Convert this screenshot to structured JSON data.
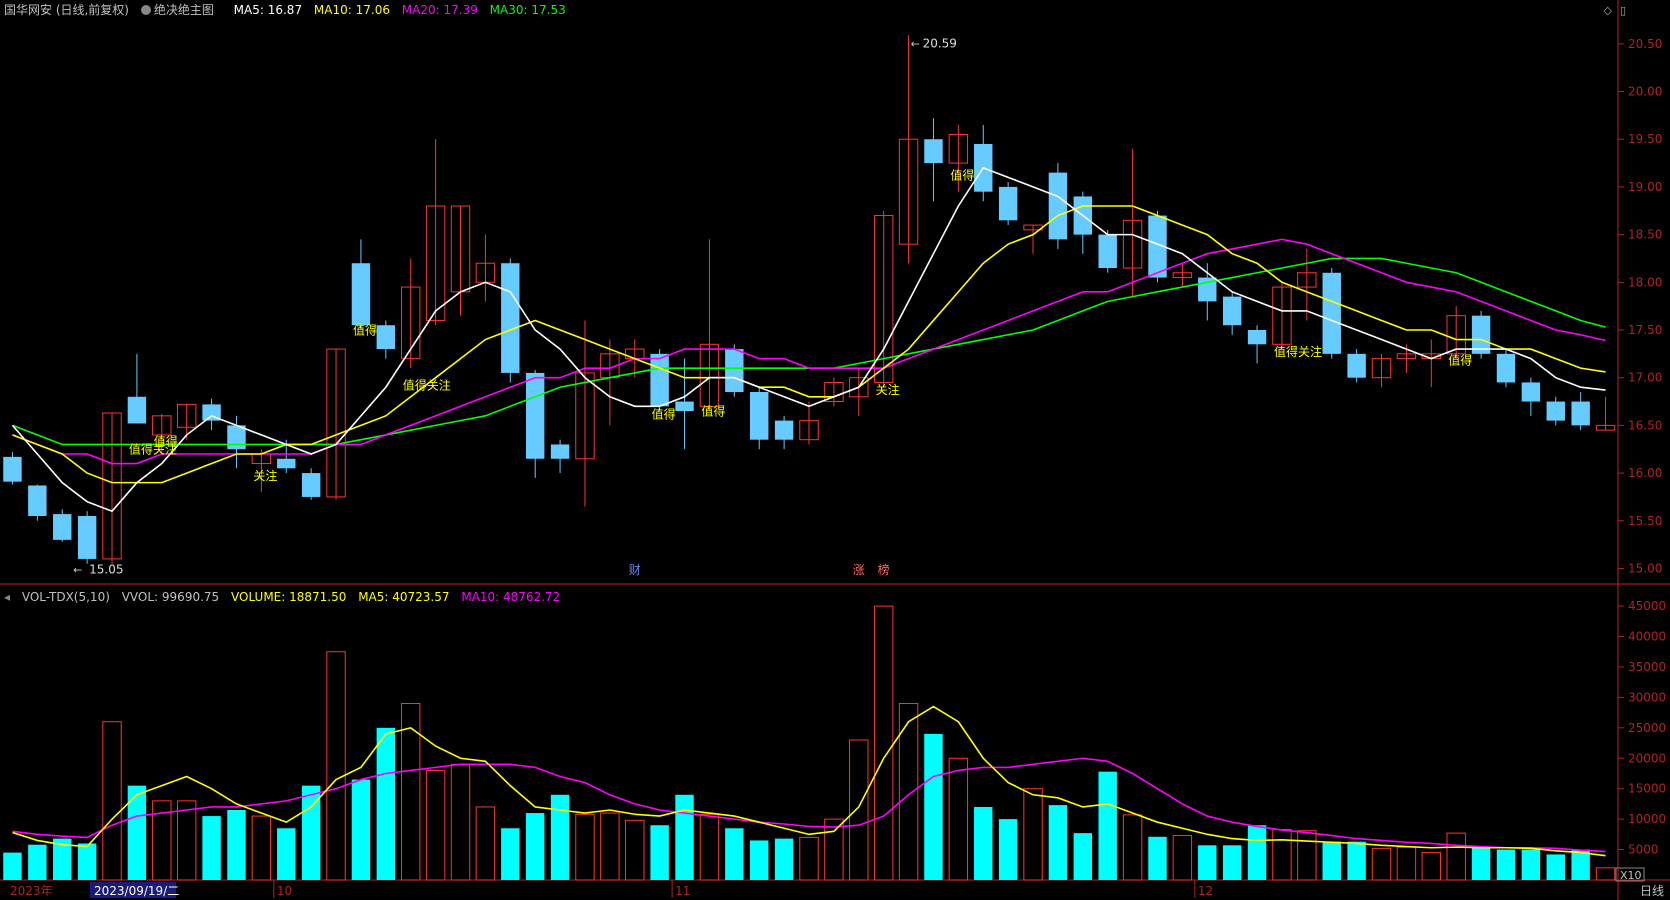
{
  "header": {
    "stock_name": "国华网安 (日线,前复权)",
    "indicator_name": "绝决绝主图",
    "ma5": "MA5: 16.87",
    "ma10": "MA10: 17.06",
    "ma20": "MA20: 17.39",
    "ma30": "MA30: 17.53"
  },
  "vol_header": {
    "name": "VOL-TDX(5,10)",
    "vvol": "VVOL: 99690.75",
    "volume": "VOLUME: 18871.50",
    "ma5": "MA5: 40723.57",
    "ma10": "MA10: 48762.72"
  },
  "colors": {
    "ma5": "#ffffff",
    "ma10": "#ffff00",
    "ma20": "#ff00ff",
    "ma30": "#00ff00",
    "up": "#ff3333",
    "down_candle": "#66ccff",
    "down_vol": "#00ffff",
    "axis": "#b22222",
    "label": "#ffff00"
  },
  "price_axis": [
    "20.50",
    "20.00",
    "19.50",
    "19.00",
    "18.50",
    "18.00",
    "17.50",
    "17.00",
    "16.50",
    "16.00",
    "15.50",
    "15.00"
  ],
  "volume_axis": [
    "45000",
    "40000",
    "35000",
    "30000",
    "25000",
    "20000",
    "15000",
    "10000",
    "5000"
  ],
  "date_axis": {
    "year": "2023年",
    "cursor_date": "2023/09/19/二",
    "months": [
      "10",
      "11",
      "12"
    ],
    "right_label": "日线",
    "zoom": "X10"
  },
  "markers": {
    "high": "20.59",
    "low": "15.05",
    "event_cai": "财",
    "event_zhang": "涨",
    "event_bang": "榜"
  },
  "signals": [
    "值得关注",
    "值得",
    "关注",
    "值得",
    "值得关注",
    "值得",
    "值得",
    "关注",
    "值得",
    "值得关注",
    "值得"
  ],
  "chart_data": {
    "type": "candlestick",
    "candles": [
      [
        16.17,
        15.91,
        16.22,
        15.88
      ],
      [
        15.87,
        15.55,
        15.88,
        15.5
      ],
      [
        15.57,
        15.3,
        15.62,
        15.28
      ],
      [
        15.55,
        15.1,
        15.6,
        15.05
      ],
      [
        15.1,
        16.63,
        16.63,
        15.05
      ],
      [
        16.8,
        16.52,
        17.25,
        16.52
      ],
      [
        16.4,
        16.6,
        16.62,
        16.2
      ],
      [
        16.48,
        16.72,
        16.72,
        16.35
      ],
      [
        16.72,
        16.55,
        16.78,
        16.45
      ],
      [
        16.5,
        16.25,
        16.6,
        16.05
      ],
      [
        16.1,
        16.2,
        16.25,
        15.8
      ],
      [
        16.15,
        16.05,
        16.35,
        16.0
      ],
      [
        16.0,
        15.75,
        16.05,
        15.72
      ],
      [
        15.75,
        17.3,
        17.3,
        15.72
      ],
      [
        18.2,
        17.55,
        18.45,
        17.5
      ],
      [
        17.55,
        17.3,
        17.6,
        17.2
      ],
      [
        17.2,
        17.95,
        18.25,
        17.1
      ],
      [
        17.6,
        18.8,
        19.5,
        17.55
      ],
      [
        17.9,
        18.8,
        18.8,
        17.65
      ],
      [
        18.0,
        18.2,
        18.5,
        17.8
      ],
      [
        18.2,
        17.05,
        18.25,
        16.95
      ],
      [
        17.05,
        16.15,
        17.08,
        15.95
      ],
      [
        16.3,
        16.15,
        16.35,
        16.0
      ],
      [
        16.15,
        17.05,
        17.6,
        15.65
      ],
      [
        17.0,
        17.25,
        17.4,
        16.5
      ],
      [
        17.2,
        17.3,
        17.4,
        17.0
      ],
      [
        17.25,
        16.7,
        17.3,
        16.65
      ],
      [
        16.75,
        16.65,
        17.2,
        16.25
      ],
      [
        16.7,
        17.35,
        18.45,
        16.65
      ],
      [
        17.3,
        16.85,
        17.35,
        16.8
      ],
      [
        16.85,
        16.35,
        16.9,
        16.25
      ],
      [
        16.55,
        16.35,
        16.6,
        16.25
      ],
      [
        16.35,
        16.55,
        16.75,
        16.3
      ],
      [
        16.75,
        16.95,
        17.0,
        16.7
      ],
      [
        16.8,
        17.0,
        17.1,
        16.6
      ],
      [
        16.95,
        18.7,
        18.75,
        16.9
      ],
      [
        18.4,
        19.5,
        20.59,
        18.2
      ],
      [
        19.5,
        19.25,
        19.72,
        18.85
      ],
      [
        19.25,
        19.55,
        19.65,
        18.95
      ],
      [
        19.45,
        18.95,
        19.65,
        18.85
      ],
      [
        19.0,
        18.65,
        19.05,
        18.6
      ],
      [
        18.55,
        18.6,
        18.6,
        18.3
      ],
      [
        19.15,
        18.45,
        19.25,
        18.35
      ],
      [
        18.9,
        18.5,
        18.95,
        18.3
      ],
      [
        18.5,
        18.15,
        18.55,
        18.1
      ],
      [
        18.15,
        18.65,
        19.4,
        17.85
      ],
      [
        18.7,
        18.05,
        18.75,
        18.0
      ],
      [
        18.05,
        18.1,
        18.2,
        17.95
      ],
      [
        18.05,
        17.8,
        18.2,
        17.6
      ],
      [
        17.85,
        17.55,
        17.9,
        17.45
      ],
      [
        17.5,
        17.35,
        17.55,
        17.15
      ],
      [
        17.35,
        17.95,
        18.0,
        17.3
      ],
      [
        17.95,
        18.1,
        18.35,
        17.6
      ],
      [
        18.1,
        17.25,
        18.15,
        17.2
      ],
      [
        17.25,
        17.0,
        17.3,
        16.95
      ],
      [
        17.0,
        17.2,
        17.25,
        16.9
      ],
      [
        17.2,
        17.25,
        17.35,
        17.05
      ],
      [
        17.2,
        17.25,
        17.4,
        16.9
      ],
      [
        17.25,
        17.65,
        17.75,
        17.2
      ],
      [
        17.65,
        17.25,
        17.7,
        17.2
      ],
      [
        17.25,
        16.95,
        17.3,
        16.9
      ],
      [
        16.95,
        16.75,
        17.0,
        16.6
      ],
      [
        16.75,
        16.55,
        16.8,
        16.5
      ],
      [
        16.75,
        16.5,
        16.85,
        16.45
      ],
      [
        16.45,
        16.5,
        16.8,
        16.45
      ]
    ],
    "volume": [
      4500,
      5800,
      6800,
      6000,
      26000,
      15500,
      13000,
      13000,
      10500,
      11500,
      10500,
      8500,
      15500,
      37500,
      16500,
      25000,
      29000,
      18000,
      19000,
      12000,
      8500,
      11000,
      14000,
      10800,
      11000,
      9800,
      9000,
      14000,
      10800,
      8500,
      6500,
      6800,
      7000,
      10000,
      23000,
      45000,
      29000,
      24000,
      20000,
      12000,
      10000,
      15000,
      12300,
      7700,
      17800,
      10700,
      7100,
      7300,
      5700,
      5700,
      9000,
      8300,
      8100,
      6300,
      6300,
      5200,
      5400,
      4500,
      7700,
      5500,
      5000,
      5000,
      4200,
      5000,
      2000
    ],
    "ma5": [
      16.5,
      16.2,
      15.9,
      15.7,
      15.6,
      15.9,
      16.1,
      16.4,
      16.6,
      16.5,
      16.4,
      16.3,
      16.2,
      16.3,
      16.6,
      16.9,
      17.3,
      17.7,
      17.9,
      18.0,
      17.9,
      17.5,
      17.3,
      17.0,
      16.8,
      16.7,
      16.7,
      16.8,
      17.0,
      17.0,
      16.9,
      16.8,
      16.7,
      16.8,
      16.9,
      17.3,
      17.8,
      18.3,
      18.8,
      19.2,
      19.1,
      19.0,
      18.9,
      18.7,
      18.5,
      18.5,
      18.4,
      18.3,
      18.1,
      17.9,
      17.8,
      17.7,
      17.7,
      17.6,
      17.5,
      17.4,
      17.3,
      17.2,
      17.3,
      17.3,
      17.3,
      17.2,
      17.0,
      16.9,
      16.87
    ],
    "ma10": [
      16.4,
      16.3,
      16.2,
      16.0,
      15.9,
      15.9,
      15.9,
      16.0,
      16.1,
      16.2,
      16.2,
      16.3,
      16.3,
      16.4,
      16.5,
      16.6,
      16.8,
      17.0,
      17.2,
      17.4,
      17.5,
      17.6,
      17.5,
      17.4,
      17.3,
      17.2,
      17.1,
      17.0,
      17.0,
      17.0,
      16.9,
      16.9,
      16.8,
      16.8,
      16.9,
      17.1,
      17.3,
      17.6,
      17.9,
      18.2,
      18.4,
      18.5,
      18.7,
      18.8,
      18.8,
      18.8,
      18.7,
      18.6,
      18.5,
      18.3,
      18.2,
      18.0,
      17.9,
      17.8,
      17.7,
      17.6,
      17.5,
      17.5,
      17.4,
      17.4,
      17.3,
      17.3,
      17.2,
      17.1,
      17.06
    ],
    "ma20": [
      16.4,
      16.3,
      16.2,
      16.2,
      16.1,
      16.1,
      16.2,
      16.2,
      16.2,
      16.2,
      16.2,
      16.2,
      16.2,
      16.3,
      16.3,
      16.4,
      16.5,
      16.6,
      16.7,
      16.8,
      16.9,
      17.0,
      17.0,
      17.1,
      17.1,
      17.2,
      17.2,
      17.3,
      17.3,
      17.3,
      17.2,
      17.2,
      17.1,
      17.1,
      17.1,
      17.1,
      17.2,
      17.3,
      17.4,
      17.5,
      17.6,
      17.7,
      17.8,
      17.9,
      17.9,
      18.0,
      18.1,
      18.2,
      18.3,
      18.35,
      18.4,
      18.45,
      18.4,
      18.3,
      18.2,
      18.1,
      18.0,
      17.95,
      17.9,
      17.8,
      17.7,
      17.6,
      17.5,
      17.45,
      17.39
    ],
    "ma30": [
      16.5,
      16.4,
      16.3,
      16.3,
      16.3,
      16.3,
      16.3,
      16.3,
      16.3,
      16.3,
      16.3,
      16.3,
      16.3,
      16.3,
      16.35,
      16.4,
      16.45,
      16.5,
      16.55,
      16.6,
      16.7,
      16.8,
      16.9,
      16.95,
      17.0,
      17.05,
      17.1,
      17.1,
      17.1,
      17.1,
      17.1,
      17.1,
      17.1,
      17.1,
      17.15,
      17.2,
      17.25,
      17.3,
      17.35,
      17.4,
      17.45,
      17.5,
      17.6,
      17.7,
      17.8,
      17.85,
      17.9,
      17.95,
      18.0,
      18.05,
      18.1,
      18.15,
      18.2,
      18.25,
      18.25,
      18.25,
      18.2,
      18.15,
      18.1,
      18.0,
      17.9,
      17.8,
      17.7,
      17.6,
      17.53
    ],
    "vol_ma5": [
      7800,
      6500,
      5800,
      5500,
      10000,
      14000,
      15500,
      17000,
      15000,
      12500,
      11000,
      9500,
      12000,
      16500,
      18500,
      24000,
      25000,
      22000,
      20000,
      19500,
      15500,
      12000,
      11500,
      11000,
      11500,
      10800,
      10500,
      11500,
      11000,
      10500,
      9500,
      8500,
      7500,
      8000,
      12000,
      20000,
      26000,
      28500,
      26000,
      20000,
      16000,
      14000,
      13500,
      12000,
      12500,
      11000,
      9500,
      8500,
      7500,
      6800,
      6500,
      6600,
      6400,
      6200,
      6000,
      5700,
      5500,
      5300,
      5400,
      5300,
      5300,
      5200,
      4800,
      4500,
      4000
    ],
    "vol_ma10": [
      8000,
      7500,
      7200,
      7000,
      9000,
      10500,
      11000,
      11500,
      12000,
      12000,
      12500,
      13000,
      14000,
      15000,
      16500,
      17500,
      18000,
      18500,
      19000,
      19000,
      19000,
      18500,
      17000,
      16000,
      14000,
      12500,
      11500,
      11000,
      10500,
      10000,
      9500,
      9200,
      8800,
      8700,
      9000,
      10500,
      14000,
      17000,
      18000,
      18500,
      18500,
      19000,
      19500,
      20000,
      19500,
      17500,
      15000,
      12500,
      10500,
      9500,
      8800,
      8200,
      7800,
      7300,
      6800,
      6500,
      6200,
      6000,
      5700,
      5500,
      5300,
      5300,
      5200,
      4900,
      4700
    ],
    "price_range": [
      14.9,
      20.75
    ],
    "volume_range": [
      0,
      46000
    ]
  }
}
